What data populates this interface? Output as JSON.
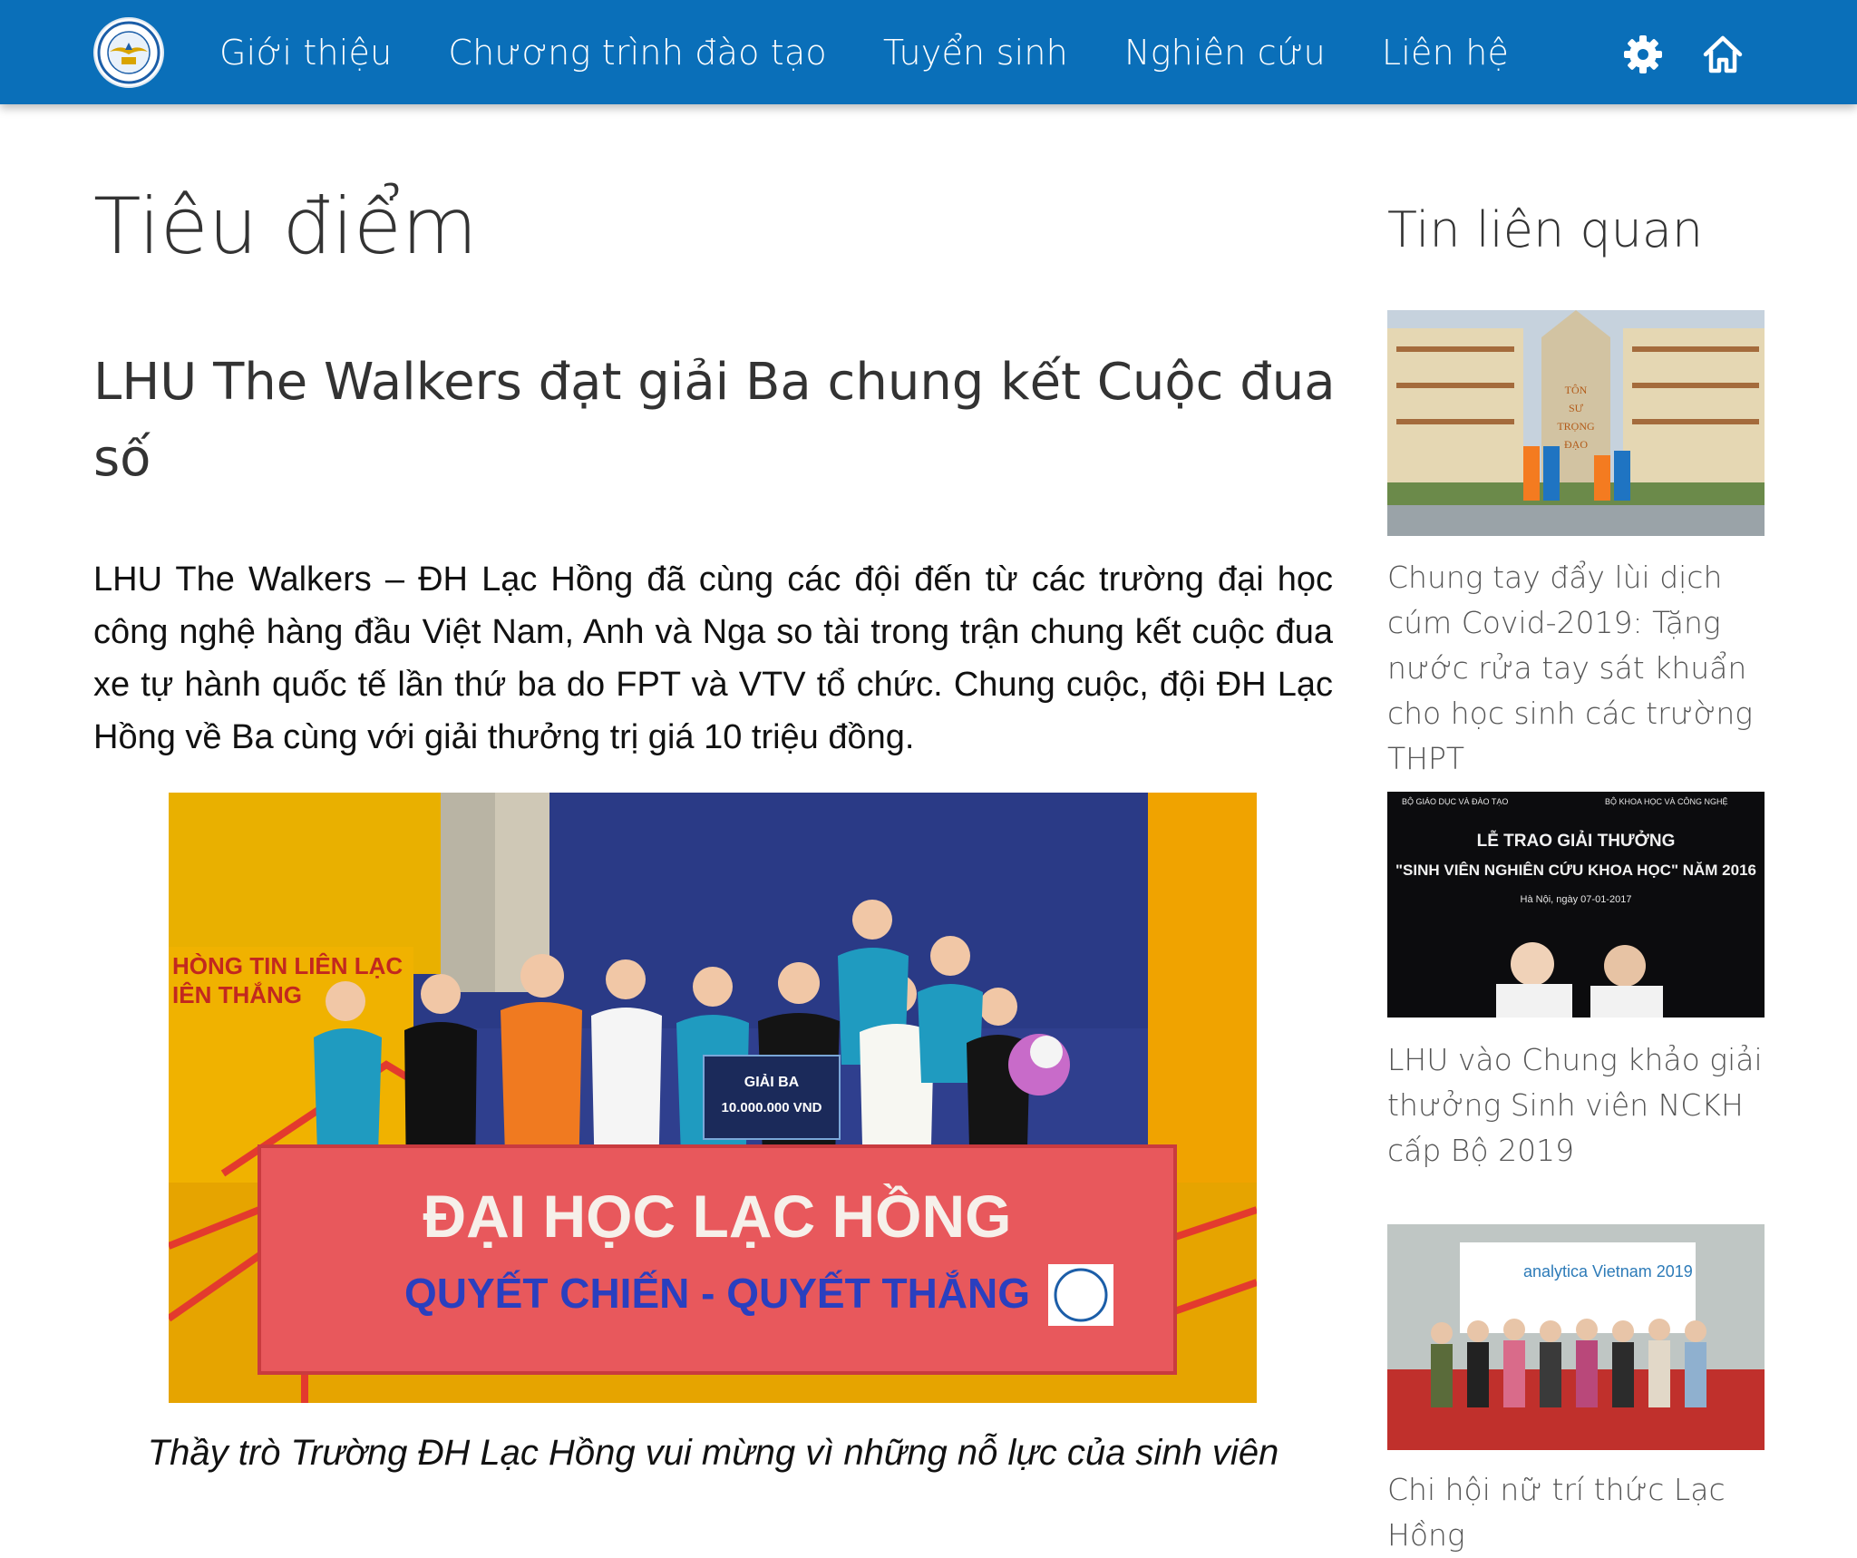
{
  "nav": {
    "items": [
      {
        "label": "Giới thiệu"
      },
      {
        "label": "Chương trình đào tạo"
      },
      {
        "label": "Tuyển sinh"
      },
      {
        "label": "Nghiên cứu"
      },
      {
        "label": "Liên hệ"
      }
    ],
    "icons": [
      "logo",
      "gear-icon",
      "home-icon"
    ],
    "background": "#0a6fb9"
  },
  "main": {
    "page_title": "Tiêu điểm",
    "article_title": "LHU The Walkers đạt giải Ba chung kết Cuộc đua số",
    "lead": "LHU The Walkers – ĐH Lạc Hồng đã cùng các đội đến từ các trường đại học công nghệ hàng đầu Việt Nam, Anh và Nga so tài trong trận chung kết cuộc đua xe tự hành quốc tế lần thứ ba do FPT và VTV tổ chức. Chung cuộc, đội ĐH Lạc Hồng về Ba cùng với giải thưởng trị giá 10 triệu đồng.",
    "photo": {
      "banner_line1": "ĐẠI HỌC LẠC HỒNG",
      "banner_line2": "QUYẾT CHIẾN - QUYẾT THẮNG",
      "board_line1": "GIẢI BA",
      "board_line2": "10.000.000 VND",
      "wall_text1": "HÒNG TIN LIÊN LẠC",
      "wall_text2": "IÊN THẮNG"
    },
    "caption": "Thầy trò Trường ĐH Lạc Hồng vui mừng vì những nỗ lực của sinh viên"
  },
  "sidebar": {
    "heading": "Tin liên quan",
    "items": [
      {
        "title": "Chung tay đẩy lùi dịch cúm Covid-2019: Tặng nước rửa tay sát khuẩn cho học sinh các trường THPT",
        "thumb_text": "TÔN SƯ TRỌNG ĐẠO"
      },
      {
        "title": "LHU vào Chung khảo giải thưởng Sinh viên NCKH cấp Bộ 2019",
        "thumb_text": "LỄ TRAO GIẢI THƯỞNG \"SINH VIÊN NGHIÊN CỨU KHOA HỌC\" NĂM 2016"
      },
      {
        "title": "Chi hội nữ trí thức Lạc Hồng",
        "thumb_text": "analytica Vietnam 2019"
      }
    ]
  }
}
